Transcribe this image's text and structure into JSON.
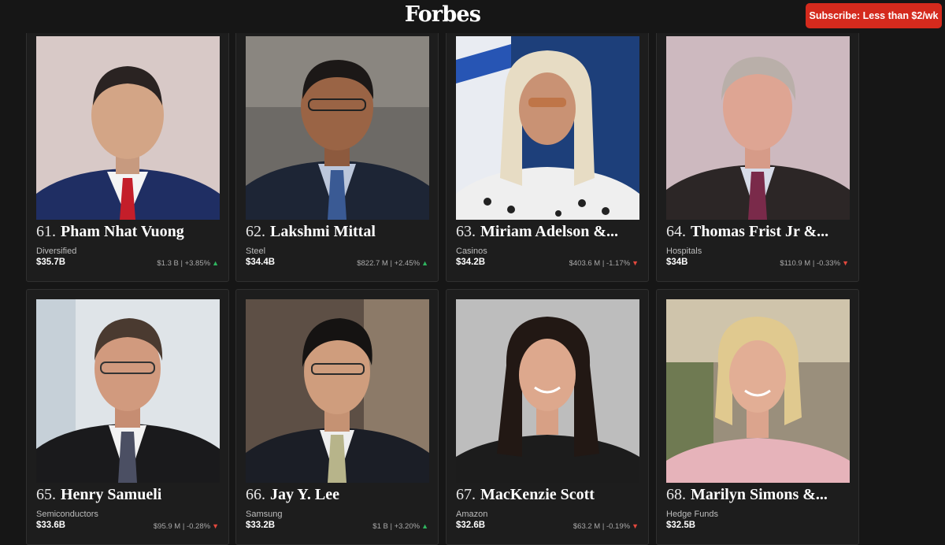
{
  "header": {
    "logo": "Forbes",
    "subscribe_label": "Subscribe: Less than $2/wk"
  },
  "cards": [
    {
      "rank": "61.",
      "name": "Pham Nhat Vuong",
      "source": "Diversified",
      "net_worth": "$35.7B",
      "change": "$1.3 B | +3.85%",
      "direction": "up"
    },
    {
      "rank": "62.",
      "name": "Lakshmi Mittal",
      "source": "Steel",
      "net_worth": "$34.4B",
      "change": "$822.7 M | +2.45%",
      "direction": "up"
    },
    {
      "rank": "63.",
      "name": "Miriam Adelson &...",
      "source": "Casinos",
      "net_worth": "$34.2B",
      "change": "$403.6 M | -1.17%",
      "direction": "down"
    },
    {
      "rank": "64.",
      "name": "Thomas Frist Jr &...",
      "source": "Hospitals",
      "net_worth": "$34B",
      "change": "$110.9 M | -0.33%",
      "direction": "down"
    },
    {
      "rank": "65.",
      "name": "Henry Samueli",
      "source": "Semiconductors",
      "net_worth": "$33.6B",
      "change": "$95.9 M | -0.28%",
      "direction": "down"
    },
    {
      "rank": "66.",
      "name": "Jay Y. Lee",
      "source": "Samsung",
      "net_worth": "$33.2B",
      "change": "$1 B | +3.20%",
      "direction": "up"
    },
    {
      "rank": "67.",
      "name": "MacKenzie Scott",
      "source": "Amazon",
      "net_worth": "$32.6B",
      "change": "$63.2 M | -0.19%",
      "direction": "down"
    },
    {
      "rank": "68.",
      "name": "Marilyn Simons &...",
      "source": "Hedge Funds",
      "net_worth": "$32.5B",
      "change": "",
      "direction": ""
    }
  ],
  "arrows": {
    "up": "▲",
    "down": "▼"
  }
}
